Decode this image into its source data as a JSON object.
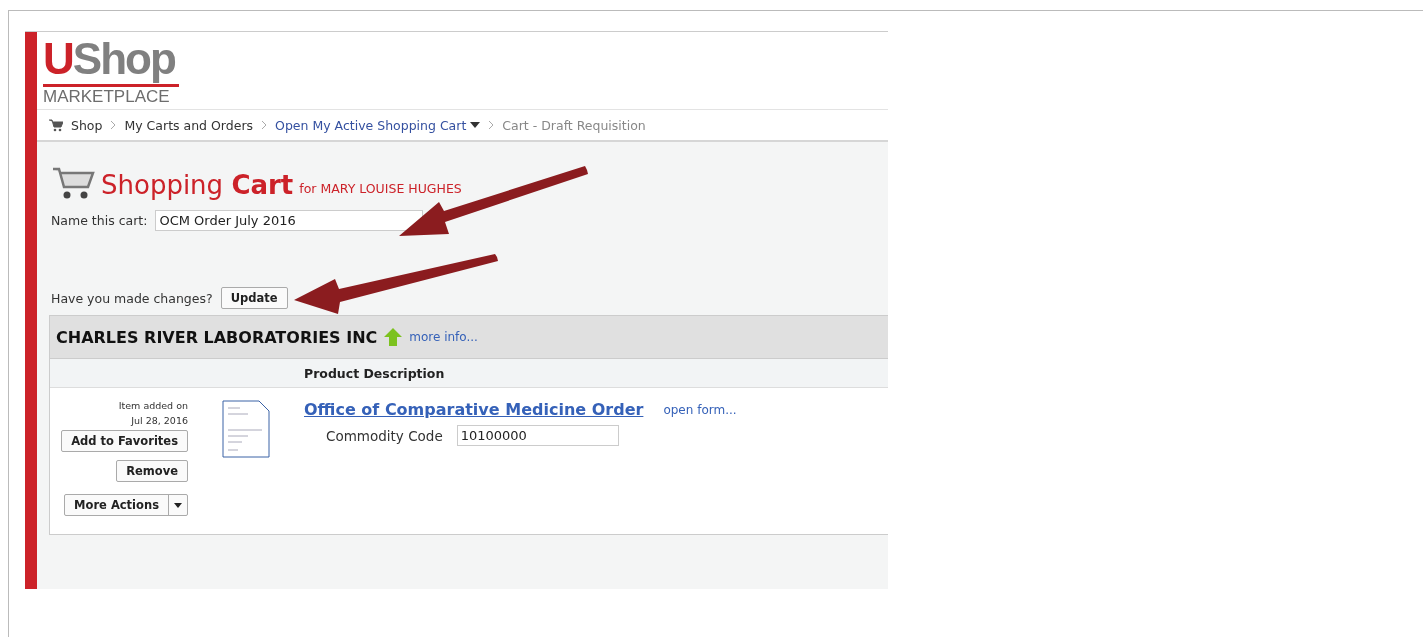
{
  "logo": {
    "mark": "U",
    "name": "Shop",
    "subtitle": "MARKETPLACE"
  },
  "breadcrumbs": [
    {
      "label": "Shop",
      "kind": "home"
    },
    {
      "label": "My Carts and Orders",
      "kind": "link"
    },
    {
      "label": "Open My Active Shopping Cart",
      "kind": "dropdown"
    },
    {
      "label": "Cart - Draft Requisition",
      "kind": "current"
    }
  ],
  "cart": {
    "title_light": "Shopping",
    "title_bold": "Cart",
    "owner": "for MARY LOUISE HUGHES",
    "name_label": "Name this cart:",
    "name_value": "OCM Order July 2016",
    "changes_label": "Have you made changes?",
    "update_button": "Update"
  },
  "supplier": {
    "name": "CHARLES RIVER LABORATORIES INC",
    "more_info": "more info..."
  },
  "table": {
    "columns": [
      "Product Description"
    ]
  },
  "item": {
    "added_label": "Item added on",
    "added_date": "Jul 28, 2016",
    "buttons": [
      "Add to Favorites",
      "Remove"
    ],
    "more_actions": "More Actions",
    "title": "Office of Comparative Medicine Order",
    "open_form": "open form...",
    "field_label": "Commodity Code",
    "field_value": "10100000"
  }
}
